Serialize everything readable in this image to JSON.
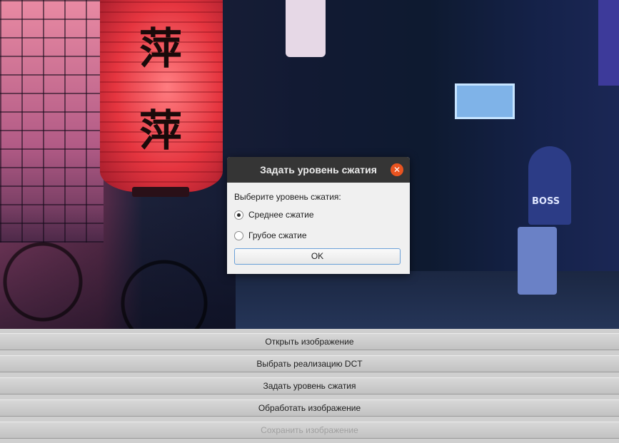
{
  "dialog": {
    "title": "Задать уровень сжатия",
    "close_glyph": "✕",
    "prompt": "Выберите уровень сжатия:",
    "options": [
      {
        "label": "Среднее сжатие",
        "selected": true
      },
      {
        "label": "Грубое сжатие",
        "selected": false
      }
    ],
    "ok_label": "OK"
  },
  "background": {
    "lantern_glyph_1": "萍",
    "lantern_glyph_2": "萍",
    "sign_text": "BOSS"
  },
  "buttons": {
    "open": "Открыть изображение",
    "dct": "Выбрать реализацию DCT",
    "compression": "Задать уровень сжатия",
    "process": "Обработать изображение",
    "save": "Сохранить изображение"
  },
  "colors": {
    "titlebar": "#353535",
    "close_accent": "#e95420",
    "focus_border": "#6aa0d8",
    "disabled_text": "#a0a0a0"
  }
}
